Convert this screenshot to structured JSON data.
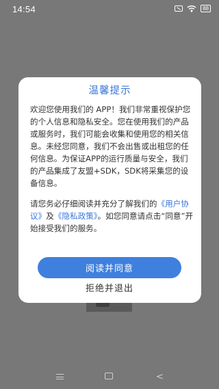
{
  "status_bar": {
    "time": "14:54",
    "battery": "88",
    "icons": [
      "sim-icon",
      "wifi-icon",
      "battery-icon"
    ]
  },
  "dialog": {
    "title": "温馨提示",
    "paragraph1": "欢迎您使用我们的 APP！我们非常重视保护您的个人信息和隐私安全。您在使用我们的产品或服务时，我们可能会收集和使用您的相关信息。未经您同意，我们不会出售或出租您的任何信息。为保证APP的运行质量与安全，我们的产品集成了友盟+SDK，SDK将采集您的设备信息。",
    "paragraph2_prefix": "请您务必仔细阅读并充分了解我们的",
    "user_agreement_link": "《用户协议》",
    "and": "及",
    "privacy_policy_link": "《隐私政策》",
    "paragraph2_suffix": "。如您同意请点击“同意”开始接受我们的服务。",
    "agree_label": "阅读并同意",
    "refuse_label": "拒绝并退出"
  },
  "colors": {
    "accent": "#3f80de",
    "title": "#3a77d8",
    "overlay": "#787878"
  },
  "nav_bar": {
    "icons": [
      "menu-icon",
      "home-icon",
      "back-icon"
    ],
    "back_glyph": "<"
  }
}
